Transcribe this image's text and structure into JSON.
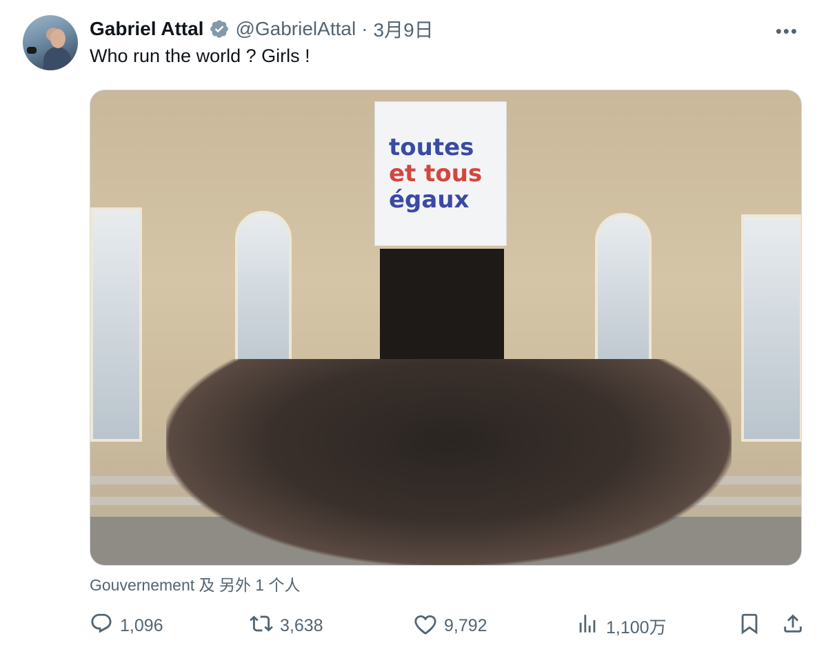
{
  "author": {
    "name": "Gabriel Attal",
    "handle": "@GabrielAttal",
    "separator": "·",
    "date": "3月9日",
    "verified": true
  },
  "more_label": "•••",
  "tweet_text": "Who run the world ? Girls !",
  "media": {
    "banner_lines": [
      "toutes",
      "et tous",
      "égaux"
    ]
  },
  "tagged": "Gouvernement 及 另外 1 个人",
  "actions": {
    "replies": "1,096",
    "retweets": "3,638",
    "likes": "9,792",
    "views": "1,100万"
  },
  "icons": {
    "verified": "verified-badge-icon",
    "reply": "reply-icon",
    "retweet": "retweet-icon",
    "like": "heart-icon",
    "views": "views-icon",
    "bookmark": "bookmark-icon",
    "share": "share-icon"
  },
  "colors": {
    "text": "#0f1419",
    "secondary": "#536471",
    "banner_blue": "#3b4aa3",
    "banner_red": "#d3463e"
  }
}
